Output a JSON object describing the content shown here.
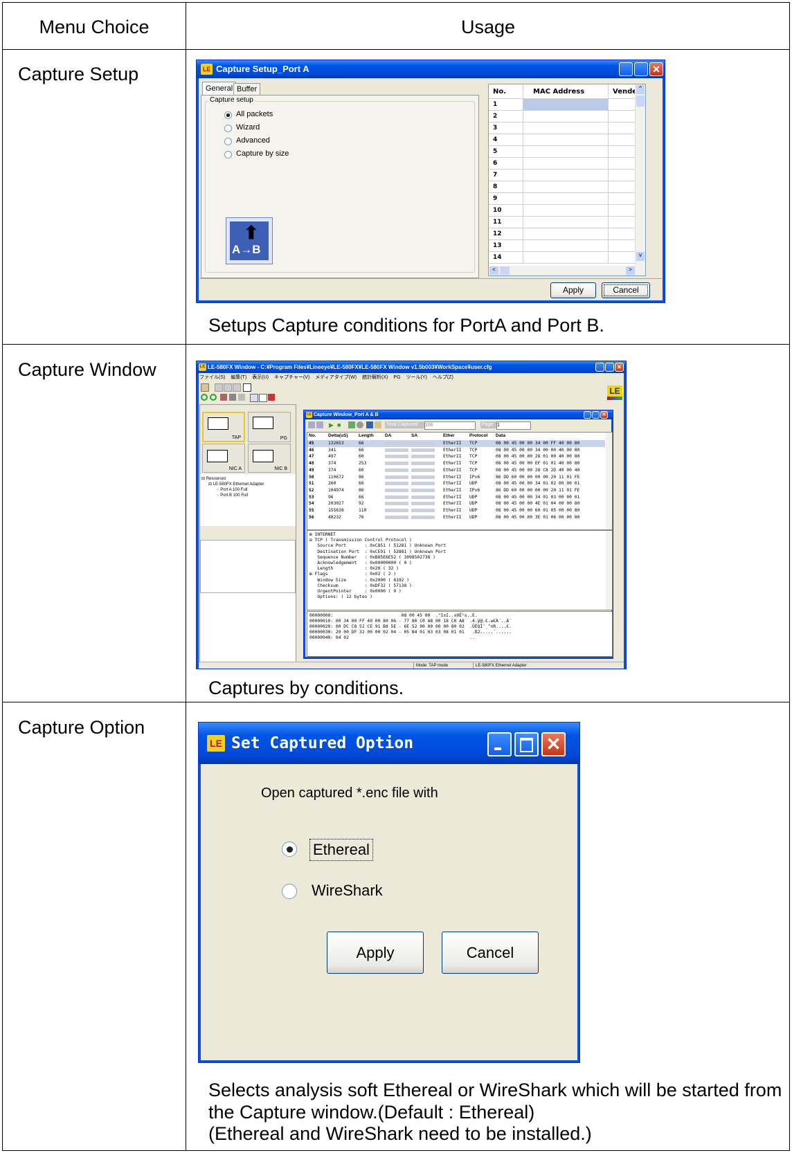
{
  "header": {
    "menu_choice": "Menu Choice",
    "usage": "Usage"
  },
  "rows": [
    {
      "menu_choice": "Capture Setup",
      "description": "Setups Capture conditions for PortA and Port B.",
      "window": {
        "title": "Capture Setup_Port A",
        "tabs": [
          "General",
          "Buffer"
        ],
        "group_label": "Capture setup",
        "options": [
          "All packets",
          "Wizard",
          "Advanced",
          "Capture by size"
        ],
        "selected_option": "All packets",
        "icon_text": "A→B",
        "columns": [
          "No.",
          "MAC Address",
          "Vende"
        ],
        "row_numbers": [
          "1",
          "2",
          "3",
          "4",
          "5",
          "6",
          "7",
          "8",
          "9",
          "10",
          "11",
          "12",
          "13",
          "14"
        ],
        "apply": "Apply",
        "cancel": "Cancel"
      }
    },
    {
      "menu_choice": "Capture Window",
      "description": "Captures by conditions.",
      "window": {
        "title": "LE-580FX Window - C:¥Program Files¥Lineeye¥LE-580FX¥LE-580FX Window v1.5b003¥WorkSpace¥user.cfg",
        "menu": [
          "ファイル(S)",
          "編集(T)",
          "表示(U)",
          "キャプチャー(V)",
          "メディアタイプ(W)",
          "統計解析(X)",
          "PG",
          "ツール(Y)",
          "ヘルプ(Z)"
        ],
        "logo": "LE",
        "modes": [
          "TAP",
          "PG",
          "NIC A",
          "NIC B"
        ],
        "tree": [
          "Resources",
          "LE-580FX Ethernet Adapter",
          "Port A 100 Full",
          "Port B 100 Full"
        ],
        "status_mode": "Mode: TAP mode",
        "status_adapter": "LE-580FX Ethernet Adapter",
        "inner": {
          "title": "Capture Window_Port A & B",
          "total_label": "Total Captured",
          "total_value": "106",
          "page_label": "Page:",
          "page_value": "1",
          "columns": [
            "No.",
            "Delta(uS)",
            "Length",
            "DA",
            "SA",
            "Ether",
            "Protocol",
            "Data"
          ],
          "packets": [
            [
              "45",
              "132653",
              "66",
              "EtherII",
              "TCP",
              "08 00 45 00 00 34 00 FF 40 00 80"
            ],
            [
              "46",
              "341",
              "66",
              "EtherII",
              "TCP",
              "08 00 45 00 00 34 00 00 40 00 80"
            ],
            [
              "47",
              "497",
              "60",
              "EtherII",
              "TCP",
              "08 00 45 00 00 28 01 00 40 00 80"
            ],
            [
              "48",
              "374",
              "253",
              "EtherII",
              "TCP",
              "08 00 45 00 00 EF 01 01 40 00 80"
            ],
            [
              "49",
              "374",
              "60",
              "EtherII",
              "TCP",
              "08 00 45 00 00 28 C8 2D 40 00 40"
            ],
            [
              "50",
              "110672",
              "86",
              "EtherII",
              "IPv6",
              "86 DD 60 00 00 00 00 20 11 01 FE"
            ],
            [
              "51",
              "260",
              "66",
              "EtherII",
              "UDP",
              "08 00 45 00 00 34 01 02 00 00 01"
            ],
            [
              "52",
              "104974",
              "86",
              "EtherII",
              "IPv6",
              "86 DD 60 00 00 00 00 20 11 01 FE"
            ],
            [
              "53",
              "96",
              "66",
              "EtherII",
              "UDP",
              "08 00 45 00 00 34 01 03 00 00 01"
            ],
            [
              "54",
              "203027",
              "92",
              "EtherII",
              "UDP",
              "08 00 45 00 00 4E 01 04 00 00 80"
            ],
            [
              "55",
              "155638",
              "110",
              "EtherII",
              "UDP",
              "08 00 45 00 00 60 01 05 00 00 80"
            ],
            [
              "56",
              "48232",
              "76",
              "EtherII",
              "UDP",
              "08 00 45 00 00 3E 01 06 00 00 80"
            ]
          ],
          "detail": [
            "⊞ INTERNET",
            "⊟ TCP ( Transmission Control Protocol )",
            "   Source Port       : 0xC851 ( 51281 ) Unknown Port",
            "   Destination Port  : 0xCE91 ( 52881 ) Unknown Port",
            "   Sequence Number   : 0xB85E6E52 ( 3098502738 )",
            "   Acknowledgement   : 0x00000000 ( 0 )",
            "   Length            : 0x20 ( 32 )",
            "⊞ Flags              : 0x02 ( 2 )",
            "   Window Size       : 0x2000 ( 8192 )",
            "   Checksum          : 0xDF32 ( 57138 )",
            "   UrgentPointer     : 0x0000 ( 0 )",
            "   Options: ( 12 bytes )"
          ],
          "hex": [
            "00000000:                          08 00 45 00  .\"I±I..x0Ê¹s..E.",
            "00000010: 00 34 00 FF 40 00 80 06 - 77 80 C0 A8 00 18 C0 A8  .4.ÿ@.€.w€À¨..À¨",
            "00000020: 00 DC C8 51 CE 91 B8 5E - 6E 52 00 00 00 00 80 02  .ÜÈQÎ'¸^nR....€.",
            "00000030: 20 00 DF 32 00 00 02 04 - 05 B4 01 03 03 08 01 01   .ß2.....´......",
            "00000040: 04 02                                              .."
          ]
        }
      }
    },
    {
      "menu_choice": "Capture Option",
      "description": "Selects analysis soft Ethereal or WireShark which will be started from the Capture window.(Default : Ethereal)",
      "note": "(Ethereal and WireShark need to be installed.)",
      "window": {
        "logo": "LE",
        "title": "Set Captured Option",
        "prompt": "Open captured  *.enc file with",
        "options": [
          "Ethereal",
          "WireShark"
        ],
        "selected_option": "Ethereal",
        "apply": "Apply",
        "cancel": "Cancel"
      }
    }
  ]
}
